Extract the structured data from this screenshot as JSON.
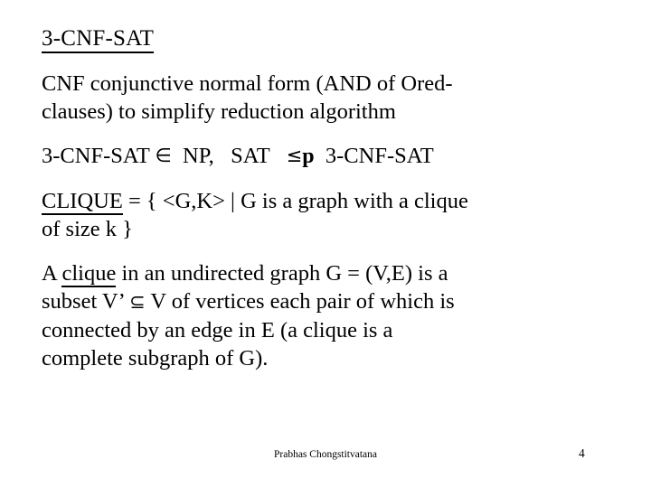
{
  "slide": {
    "page_number": "4",
    "author": "Prabhas Chongstitvatana",
    "background_color": "#ffffff",
    "text_color": "#000000",
    "title": "3-CNF-SAT",
    "blocks": {
      "definition": {
        "line1": "CNF conjunctive normal form (AND of Ored-",
        "line2": "clauses)  to simplify reduction algorithm"
      },
      "complexity": {
        "part1": "3-CNF-SAT",
        "element_of": "∈",
        "part2": "NP,",
        "part3": "SAT",
        "leq": "≤",
        "p": "p",
        "part4": "3-CNF-SAT"
      },
      "clique_set": {
        "term": "CLIQUE",
        "line1_rest": " = { <G,K> | G is a graph with a clique",
        "line2": "of size k }"
      },
      "clique_def": {
        "pre": "A ",
        "term": "clique",
        "line1_rest": " in an undirected graph G = (V,E) is a",
        "line2_pre": "subset  V’ ",
        "subset_sym": "⊆",
        "line2_rest": " V of vertices each pair of which is",
        "line3": "connected by an edge in E (a clique is a",
        "line4": "complete subgraph of G)."
      }
    }
  }
}
